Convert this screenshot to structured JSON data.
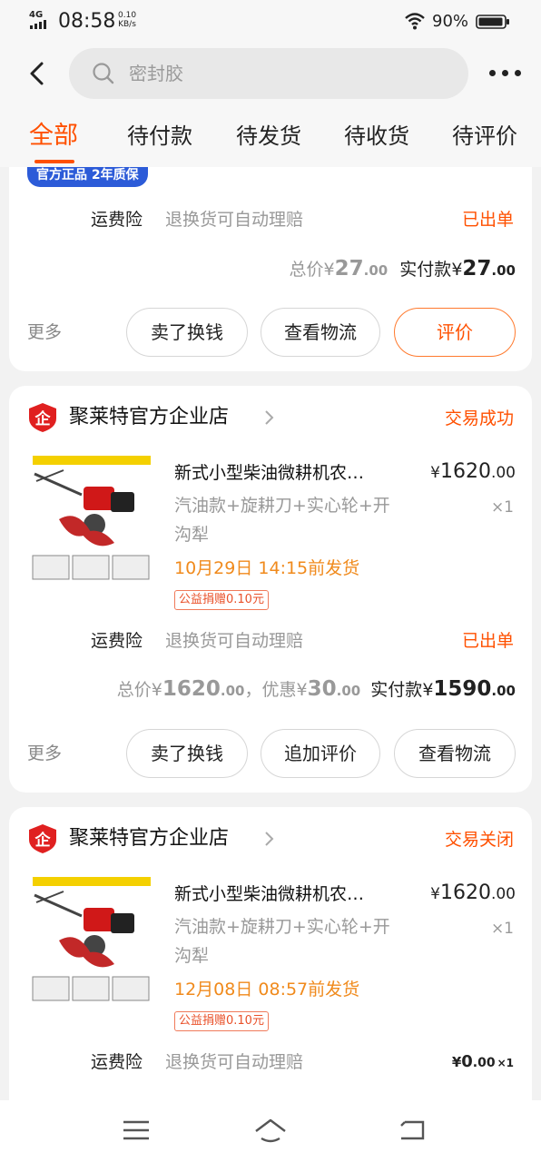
{
  "status_bar": {
    "network": "4G",
    "time": "08:58",
    "speed_value": "0.10",
    "speed_unit": "KB/s",
    "battery": "90%"
  },
  "search": {
    "placeholder": "密封胶"
  },
  "tabs": [
    {
      "label": "全部",
      "active": true
    },
    {
      "label": "待付款"
    },
    {
      "label": "待发货"
    },
    {
      "label": "待收货"
    },
    {
      "label": "待评价"
    }
  ],
  "colors": {
    "accent": "#ff5000",
    "badge_blue": "#2c5bd8",
    "ship_time": "#f08a1c"
  },
  "order_partial": {
    "badge": "官方正品 2年质保",
    "insurance_label": "运费险",
    "insurance_desc": "退换货可自动理赔",
    "insurance_status": "已出单",
    "total_label": "总价",
    "total_currency": "¥",
    "total_int": "27",
    "total_dec": ".00",
    "paid_label": "实付款",
    "paid_currency": "¥",
    "paid_int": "27",
    "paid_dec": ".00",
    "more": "更多",
    "buttons": [
      "卖了换钱",
      "查看物流",
      "评价"
    ]
  },
  "order2": {
    "shop": "聚莱特官方企业店",
    "shop_icon": "shop-enterprise-icon",
    "status": "交易成功",
    "product_title": "新式小型柴油微耕机农…",
    "price_currency": "¥",
    "price_int": "1620",
    "price_dec": ".00",
    "spec": "汽油款+旋耕刀+实心轮+开沟犁",
    "qty": "×1",
    "ship_time": "10月29日 14:15前发货",
    "charity": "公益捐赠0.10元",
    "insurance_label": "运费险",
    "insurance_desc": "退换货可自动理赔",
    "insurance_status": "已出单",
    "total_label": "总价",
    "total_currency": "¥",
    "total_int": "1620",
    "total_dec": ".00",
    "sep": "，",
    "discount_label": "优惠",
    "discount_currency": "¥",
    "discount_int": "30",
    "discount_dec": ".00",
    "paid_label": "实付款",
    "paid_currency": "¥",
    "paid_int": "1590",
    "paid_dec": ".00",
    "more": "更多",
    "buttons": [
      "卖了换钱",
      "追加评价",
      "查看物流"
    ]
  },
  "order3": {
    "shop": "聚莱特官方企业店",
    "status": "交易关闭",
    "product_title": "新式小型柴油微耕机农…",
    "price_currency": "¥",
    "price_int": "1620",
    "price_dec": ".00",
    "spec": "汽油款+旋耕刀+实心轮+开沟犁",
    "qty": "×1",
    "ship_time": "12月08日 08:57前发货",
    "charity": "公益捐赠0.10元",
    "insurance_label": "运费险",
    "insurance_desc": "退换货可自动理赔",
    "paid_currency": "¥",
    "paid_int": "0",
    "paid_dec": ".00",
    "paid_qty": "×1"
  },
  "navbar": {
    "icons": [
      "menu-icon",
      "home-icon",
      "back-gesture-icon"
    ]
  }
}
